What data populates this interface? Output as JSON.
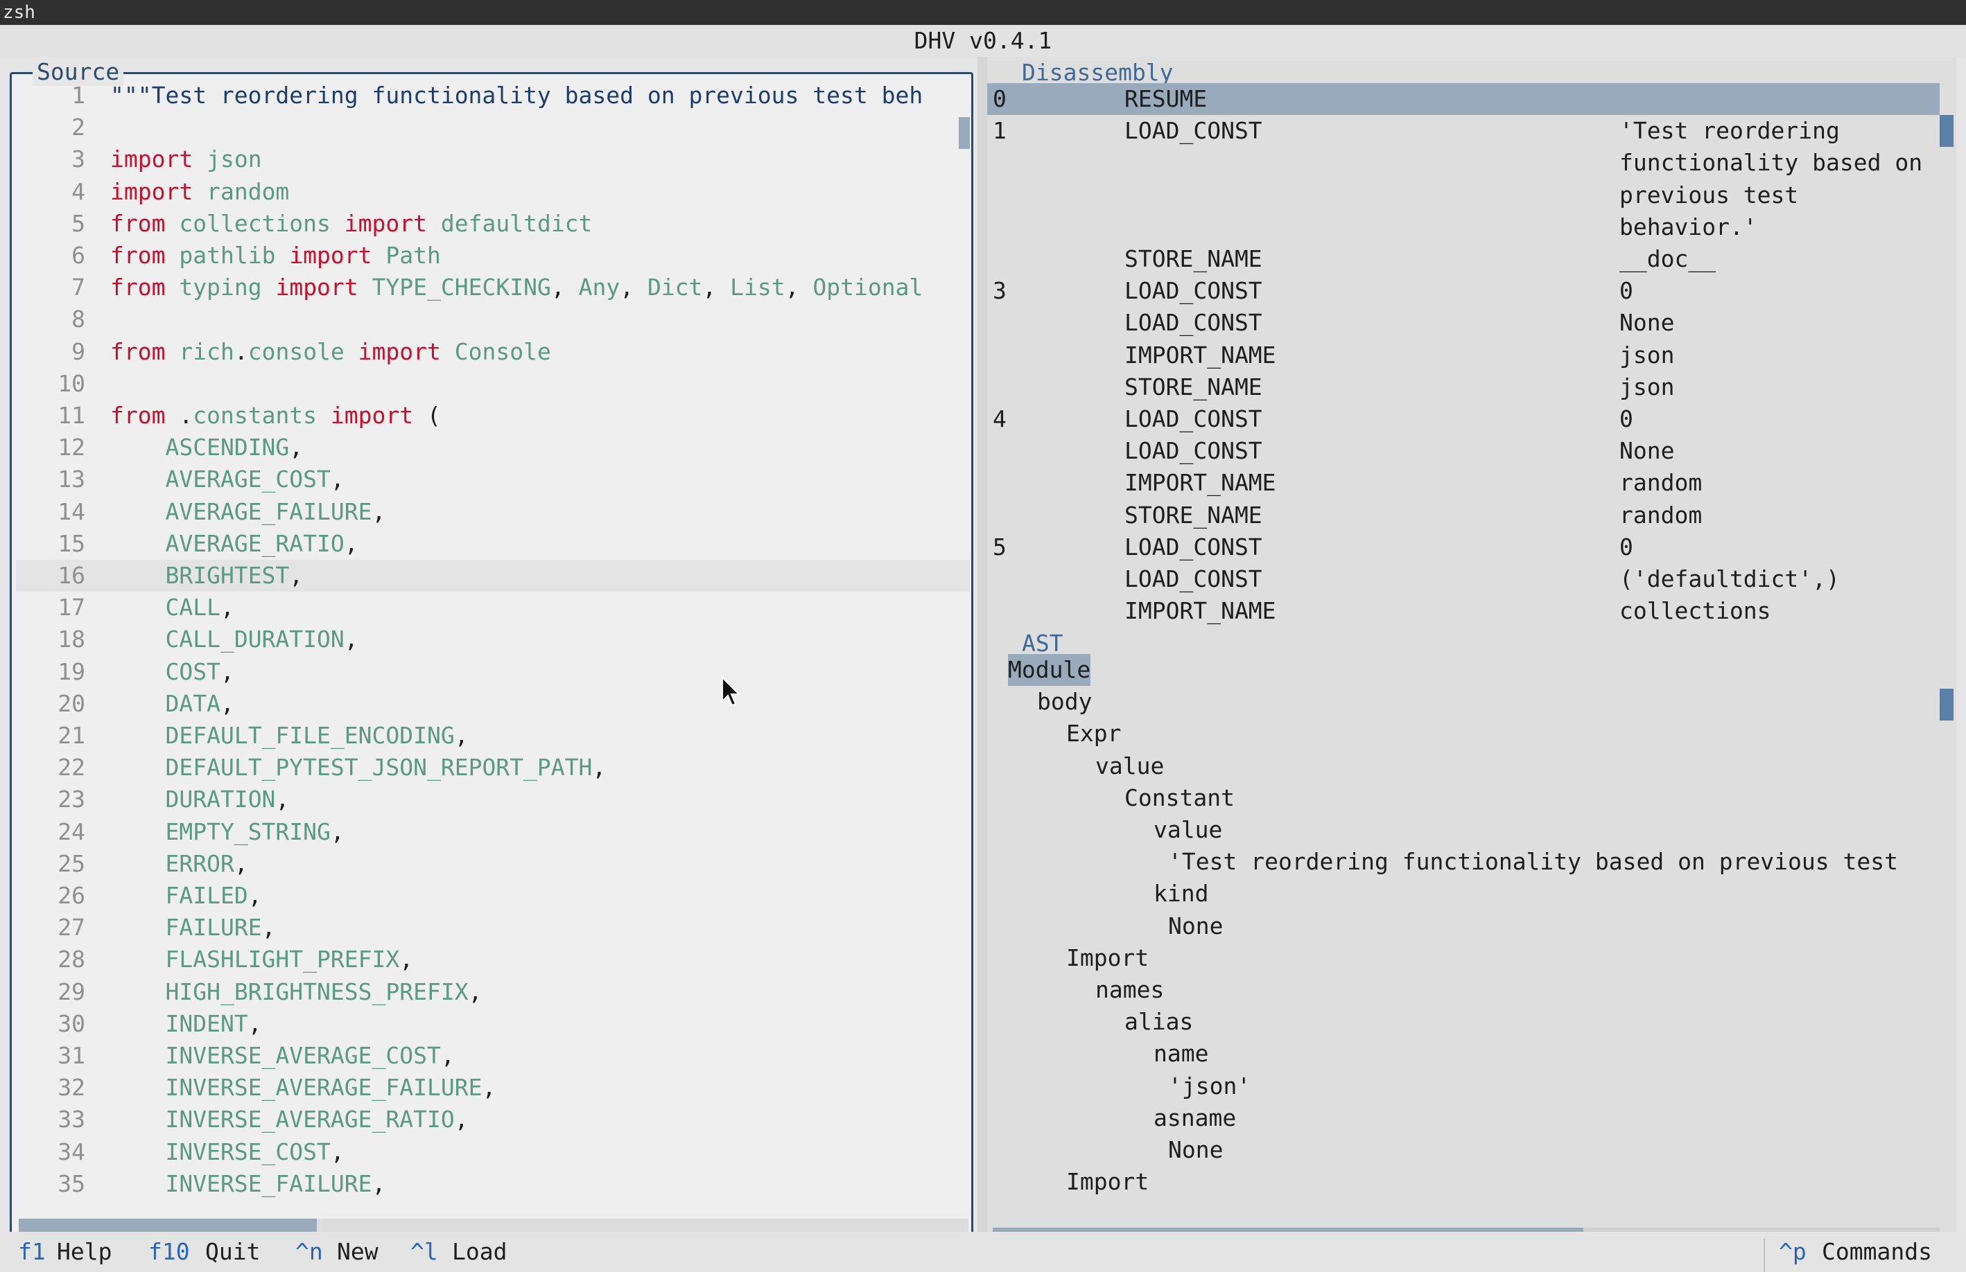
{
  "terminal": {
    "title": "zsh"
  },
  "app": {
    "title": "DHV v0.4.1"
  },
  "source": {
    "label": "Source",
    "current_line": 16,
    "lines": [
      {
        "n": "1",
        "tokens": [
          {
            "t": "\"\"\"Test reordering functionality based on previous test beh",
            "c": "str"
          }
        ]
      },
      {
        "n": "2",
        "tokens": []
      },
      {
        "n": "3",
        "tokens": [
          {
            "t": "import",
            "c": "kw"
          },
          {
            "t": " ",
            "c": "pl"
          },
          {
            "t": "json",
            "c": "id"
          }
        ]
      },
      {
        "n": "4",
        "tokens": [
          {
            "t": "import",
            "c": "kw"
          },
          {
            "t": " ",
            "c": "pl"
          },
          {
            "t": "random",
            "c": "id"
          }
        ]
      },
      {
        "n": "5",
        "tokens": [
          {
            "t": "from",
            "c": "kw"
          },
          {
            "t": " ",
            "c": "pl"
          },
          {
            "t": "collections",
            "c": "id"
          },
          {
            "t": " ",
            "c": "pl"
          },
          {
            "t": "import",
            "c": "kw"
          },
          {
            "t": " ",
            "c": "pl"
          },
          {
            "t": "defaultdict",
            "c": "id"
          }
        ]
      },
      {
        "n": "6",
        "tokens": [
          {
            "t": "from",
            "c": "kw"
          },
          {
            "t": " ",
            "c": "pl"
          },
          {
            "t": "pathlib",
            "c": "id"
          },
          {
            "t": " ",
            "c": "pl"
          },
          {
            "t": "import",
            "c": "kw"
          },
          {
            "t": " ",
            "c": "pl"
          },
          {
            "t": "Path",
            "c": "id"
          }
        ]
      },
      {
        "n": "7",
        "tokens": [
          {
            "t": "from",
            "c": "kw"
          },
          {
            "t": " ",
            "c": "pl"
          },
          {
            "t": "typing",
            "c": "id"
          },
          {
            "t": " ",
            "c": "pl"
          },
          {
            "t": "import",
            "c": "kw"
          },
          {
            "t": " ",
            "c": "pl"
          },
          {
            "t": "TYPE_CHECKING",
            "c": "id"
          },
          {
            "t": ", ",
            "c": "pl"
          },
          {
            "t": "Any",
            "c": "id"
          },
          {
            "t": ", ",
            "c": "pl"
          },
          {
            "t": "Dict",
            "c": "id"
          },
          {
            "t": ", ",
            "c": "pl"
          },
          {
            "t": "List",
            "c": "id"
          },
          {
            "t": ", ",
            "c": "pl"
          },
          {
            "t": "Optional",
            "c": "id"
          }
        ]
      },
      {
        "n": "8",
        "tokens": []
      },
      {
        "n": "9",
        "tokens": [
          {
            "t": "from",
            "c": "kw"
          },
          {
            "t": " ",
            "c": "pl"
          },
          {
            "t": "rich",
            "c": "id"
          },
          {
            "t": ".",
            "c": "pl"
          },
          {
            "t": "console",
            "c": "id"
          },
          {
            "t": " ",
            "c": "pl"
          },
          {
            "t": "import",
            "c": "kw"
          },
          {
            "t": " ",
            "c": "pl"
          },
          {
            "t": "Console",
            "c": "id"
          }
        ]
      },
      {
        "n": "10",
        "tokens": []
      },
      {
        "n": "11",
        "tokens": [
          {
            "t": "from",
            "c": "kw"
          },
          {
            "t": " .",
            "c": "pl"
          },
          {
            "t": "constants",
            "c": "id"
          },
          {
            "t": " ",
            "c": "pl"
          },
          {
            "t": "import",
            "c": "kw"
          },
          {
            "t": " (",
            "c": "pl"
          }
        ]
      },
      {
        "n": "12",
        "tokens": [
          {
            "t": "    ",
            "c": "pl"
          },
          {
            "t": "ASCENDING",
            "c": "id"
          },
          {
            "t": ",",
            "c": "pl"
          }
        ]
      },
      {
        "n": "13",
        "tokens": [
          {
            "t": "    ",
            "c": "pl"
          },
          {
            "t": "AVERAGE_COST",
            "c": "id"
          },
          {
            "t": ",",
            "c": "pl"
          }
        ]
      },
      {
        "n": "14",
        "tokens": [
          {
            "t": "    ",
            "c": "pl"
          },
          {
            "t": "AVERAGE_FAILURE",
            "c": "id"
          },
          {
            "t": ",",
            "c": "pl"
          }
        ]
      },
      {
        "n": "15",
        "tokens": [
          {
            "t": "    ",
            "c": "pl"
          },
          {
            "t": "AVERAGE_RATIO",
            "c": "id"
          },
          {
            "t": ",",
            "c": "pl"
          }
        ]
      },
      {
        "n": "16",
        "tokens": [
          {
            "t": "    ",
            "c": "pl"
          },
          {
            "t": "BRIGHTEST",
            "c": "id"
          },
          {
            "t": ",",
            "c": "pl"
          }
        ]
      },
      {
        "n": "17",
        "tokens": [
          {
            "t": "    ",
            "c": "pl"
          },
          {
            "t": "CALL",
            "c": "id"
          },
          {
            "t": ",",
            "c": "pl"
          }
        ]
      },
      {
        "n": "18",
        "tokens": [
          {
            "t": "    ",
            "c": "pl"
          },
          {
            "t": "CALL_DURATION",
            "c": "id"
          },
          {
            "t": ",",
            "c": "pl"
          }
        ]
      },
      {
        "n": "19",
        "tokens": [
          {
            "t": "    ",
            "c": "pl"
          },
          {
            "t": "COST",
            "c": "id"
          },
          {
            "t": ",",
            "c": "pl"
          }
        ]
      },
      {
        "n": "20",
        "tokens": [
          {
            "t": "    ",
            "c": "pl"
          },
          {
            "t": "DATA",
            "c": "id"
          },
          {
            "t": ",",
            "c": "pl"
          }
        ]
      },
      {
        "n": "21",
        "tokens": [
          {
            "t": "    ",
            "c": "pl"
          },
          {
            "t": "DEFAULT_FILE_ENCODING",
            "c": "id"
          },
          {
            "t": ",",
            "c": "pl"
          }
        ]
      },
      {
        "n": "22",
        "tokens": [
          {
            "t": "    ",
            "c": "pl"
          },
          {
            "t": "DEFAULT_PYTEST_JSON_REPORT_PATH",
            "c": "id"
          },
          {
            "t": ",",
            "c": "pl"
          }
        ]
      },
      {
        "n": "23",
        "tokens": [
          {
            "t": "    ",
            "c": "pl"
          },
          {
            "t": "DURATION",
            "c": "id"
          },
          {
            "t": ",",
            "c": "pl"
          }
        ]
      },
      {
        "n": "24",
        "tokens": [
          {
            "t": "    ",
            "c": "pl"
          },
          {
            "t": "EMPTY_STRING",
            "c": "id"
          },
          {
            "t": ",",
            "c": "pl"
          }
        ]
      },
      {
        "n": "25",
        "tokens": [
          {
            "t": "    ",
            "c": "pl"
          },
          {
            "t": "ERROR",
            "c": "id"
          },
          {
            "t": ",",
            "c": "pl"
          }
        ]
      },
      {
        "n": "26",
        "tokens": [
          {
            "t": "    ",
            "c": "pl"
          },
          {
            "t": "FAILED",
            "c": "id"
          },
          {
            "t": ",",
            "c": "pl"
          }
        ]
      },
      {
        "n": "27",
        "tokens": [
          {
            "t": "    ",
            "c": "pl"
          },
          {
            "t": "FAILURE",
            "c": "id"
          },
          {
            "t": ",",
            "c": "pl"
          }
        ]
      },
      {
        "n": "28",
        "tokens": [
          {
            "t": "    ",
            "c": "pl"
          },
          {
            "t": "FLASHLIGHT_PREFIX",
            "c": "id"
          },
          {
            "t": ",",
            "c": "pl"
          }
        ]
      },
      {
        "n": "29",
        "tokens": [
          {
            "t": "    ",
            "c": "pl"
          },
          {
            "t": "HIGH_BRIGHTNESS_PREFIX",
            "c": "id"
          },
          {
            "t": ",",
            "c": "pl"
          }
        ]
      },
      {
        "n": "30",
        "tokens": [
          {
            "t": "    ",
            "c": "pl"
          },
          {
            "t": "INDENT",
            "c": "id"
          },
          {
            "t": ",",
            "c": "pl"
          }
        ]
      },
      {
        "n": "31",
        "tokens": [
          {
            "t": "    ",
            "c": "pl"
          },
          {
            "t": "INVERSE_AVERAGE_COST",
            "c": "id"
          },
          {
            "t": ",",
            "c": "pl"
          }
        ]
      },
      {
        "n": "32",
        "tokens": [
          {
            "t": "    ",
            "c": "pl"
          },
          {
            "t": "INVERSE_AVERAGE_FAILURE",
            "c": "id"
          },
          {
            "t": ",",
            "c": "pl"
          }
        ]
      },
      {
        "n": "33",
        "tokens": [
          {
            "t": "    ",
            "c": "pl"
          },
          {
            "t": "INVERSE_AVERAGE_RATIO",
            "c": "id"
          },
          {
            "t": ",",
            "c": "pl"
          }
        ]
      },
      {
        "n": "34",
        "tokens": [
          {
            "t": "    ",
            "c": "pl"
          },
          {
            "t": "INVERSE_COST",
            "c": "id"
          },
          {
            "t": ",",
            "c": "pl"
          }
        ]
      },
      {
        "n": "35",
        "tokens": [
          {
            "t": "    ",
            "c": "pl"
          },
          {
            "t": "INVERSE_FAILURE",
            "c": "id"
          },
          {
            "t": ",",
            "c": "pl"
          }
        ]
      }
    ]
  },
  "disassembly": {
    "label": "Disassembly",
    "selected_row": 0,
    "rows": [
      {
        "line": "0",
        "op": "RESUME",
        "arg": ""
      },
      {
        "line": "1",
        "op": "LOAD_CONST",
        "arg": "'Test reordering"
      },
      {
        "line": "",
        "op": "",
        "arg": "functionality based on"
      },
      {
        "line": "",
        "op": "",
        "arg": "previous test"
      },
      {
        "line": "",
        "op": "",
        "arg": "behavior.'"
      },
      {
        "line": "",
        "op": "STORE_NAME",
        "arg": "__doc__"
      },
      {
        "line": "3",
        "op": "LOAD_CONST",
        "arg": "0"
      },
      {
        "line": "",
        "op": "LOAD_CONST",
        "arg": "None"
      },
      {
        "line": "",
        "op": "IMPORT_NAME",
        "arg": "json"
      },
      {
        "line": "",
        "op": "STORE_NAME",
        "arg": "json"
      },
      {
        "line": "4",
        "op": "LOAD_CONST",
        "arg": "0"
      },
      {
        "line": "",
        "op": "LOAD_CONST",
        "arg": "None"
      },
      {
        "line": "",
        "op": "IMPORT_NAME",
        "arg": "random"
      },
      {
        "line": "",
        "op": "STORE_NAME",
        "arg": "random"
      },
      {
        "line": "5",
        "op": "LOAD_CONST",
        "arg": "0"
      },
      {
        "line": "",
        "op": "LOAD_CONST",
        "arg": "('defaultdict',)"
      },
      {
        "line": "",
        "op": "IMPORT_NAME",
        "arg": "collections"
      }
    ]
  },
  "ast": {
    "label": "AST",
    "selected_row": 0,
    "nodes": [
      {
        "text": "Module",
        "depth": 0
      },
      {
        "text": "body",
        "depth": 1
      },
      {
        "text": "Expr",
        "depth": 2
      },
      {
        "text": "value",
        "depth": 3
      },
      {
        "text": "Constant",
        "depth": 4
      },
      {
        "text": "value",
        "depth": 5
      },
      {
        "text": "'Test reordering functionality based on previous test",
        "depth": 5.5
      },
      {
        "text": "kind",
        "depth": 5
      },
      {
        "text": "None",
        "depth": 5.5
      },
      {
        "text": "Import",
        "depth": 2
      },
      {
        "text": "names",
        "depth": 3
      },
      {
        "text": "alias",
        "depth": 4
      },
      {
        "text": "name",
        "depth": 5
      },
      {
        "text": "'json'",
        "depth": 5.5
      },
      {
        "text": "asname",
        "depth": 5
      },
      {
        "text": "None",
        "depth": 5.5
      },
      {
        "text": "Import",
        "depth": 2
      }
    ]
  },
  "footer": {
    "items": [
      {
        "key": "f1",
        "label": "Help"
      },
      {
        "key": "f10",
        "label": "Quit"
      },
      {
        "key": "^n",
        "label": "New"
      },
      {
        "key": "^l",
        "label": "Load"
      }
    ],
    "commands": {
      "key": "^p",
      "label": "Commands"
    }
  },
  "colors": {
    "keyword": "#c8102e",
    "identifier": "#5a9a84",
    "string": "#1c3d70",
    "selection": "#98aabb",
    "accent": "#2c4a6e",
    "key": "#2966b8"
  }
}
